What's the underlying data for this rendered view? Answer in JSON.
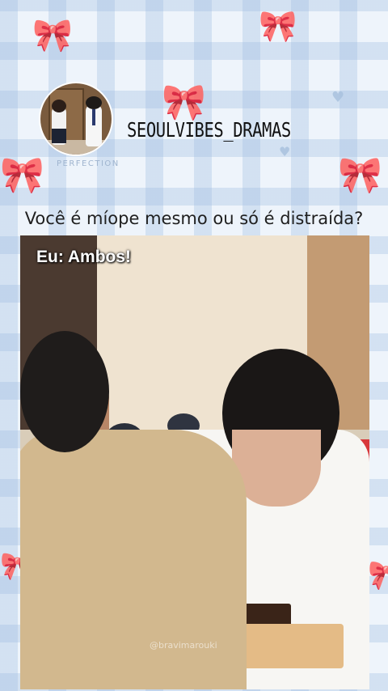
{
  "profile": {
    "handle": "SEOULVIBES_DRAMAS",
    "avatar_caption": "PERFECTION"
  },
  "post": {
    "question": "Você é míope mesmo ou só é distraída?"
  },
  "video": {
    "overlay_text": "Eu: Ambos!",
    "watermark": "@bravimarouki"
  },
  "decorations": {
    "background_pattern": "gingham-light-blue",
    "bow_icon": "ribbon-bow",
    "accent_color": "#a9c2df"
  }
}
